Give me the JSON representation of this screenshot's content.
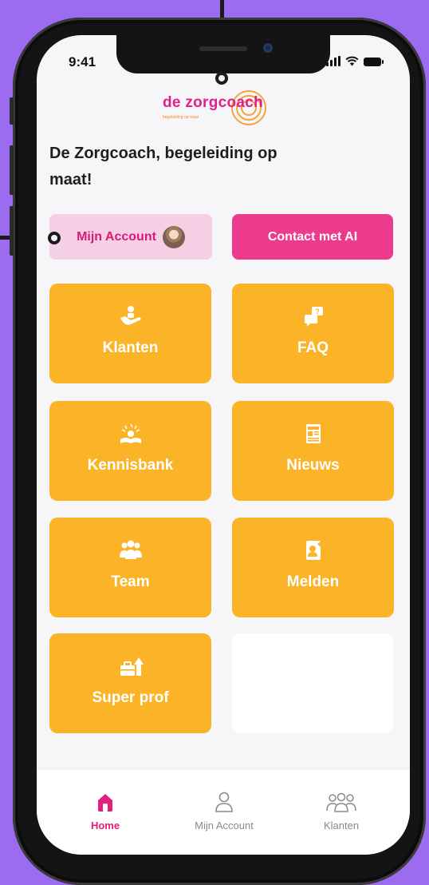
{
  "status_bar": {
    "time": "9:41"
  },
  "logo": {
    "name": "de zorgcoach",
    "tagline": "begeleiding op maat"
  },
  "headline": "De Zorgcoach, begeleiding op maat!",
  "actions": {
    "account_label": "Mijn Account",
    "contact_label": "Contact met AI"
  },
  "tiles": [
    {
      "label": "Klanten",
      "icon": "care-hand-icon"
    },
    {
      "label": "FAQ",
      "icon": "faq-chat-icon"
    },
    {
      "label": "Kennisbank",
      "icon": "knowledge-book-icon"
    },
    {
      "label": "Nieuws",
      "icon": "newspaper-icon"
    },
    {
      "label": "Team",
      "icon": "team-icon"
    },
    {
      "label": "Melden",
      "icon": "report-icon"
    },
    {
      "label": "Super prof",
      "icon": "growth-briefcase-icon"
    }
  ],
  "tabbar": {
    "items": [
      {
        "label": "Home",
        "icon": "home-icon",
        "active": true
      },
      {
        "label": "Mijn Account",
        "icon": "user-icon",
        "active": false
      },
      {
        "label": "Klanten",
        "icon": "group-icon",
        "active": false
      }
    ]
  },
  "colors": {
    "background": "#9b6cf0",
    "tile": "#fbb428",
    "accent_pink": "#ec3b8d",
    "account_bg": "#f5cfe3"
  }
}
